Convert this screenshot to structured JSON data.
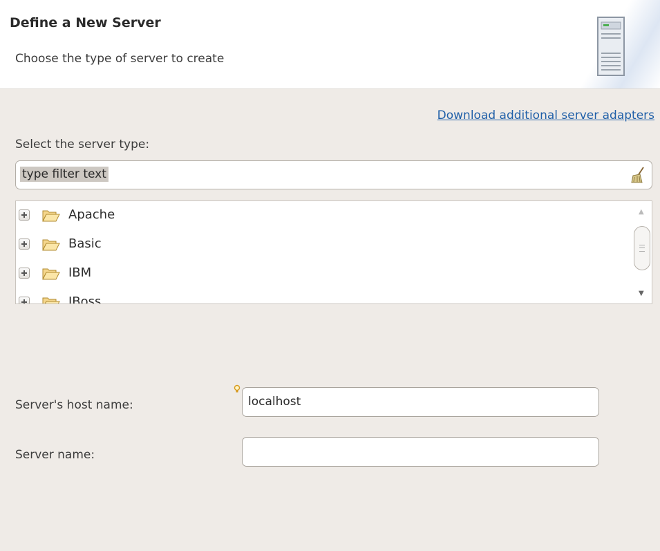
{
  "header": {
    "title": "Define a New Server",
    "description": "Choose the type of server to create",
    "icon": "server-icon"
  },
  "download_link": "Download additional server adapters",
  "select_label": "Select the server type:",
  "filter": {
    "value": "type filter text",
    "clear_icon": "clear-filter-icon"
  },
  "tree": {
    "items": [
      {
        "label": "Apache"
      },
      {
        "label": "Basic"
      },
      {
        "label": "IBM"
      },
      {
        "label": "JBoss"
      }
    ]
  },
  "host": {
    "label": "Server's host name:",
    "value": "localhost",
    "hint_icon": "content-assist-bulb-icon"
  },
  "server_name": {
    "label": "Server name:",
    "value": ""
  },
  "colors": {
    "link": "#1f5fa8",
    "background": "#efebe7",
    "header_bg": "#ffffff"
  }
}
